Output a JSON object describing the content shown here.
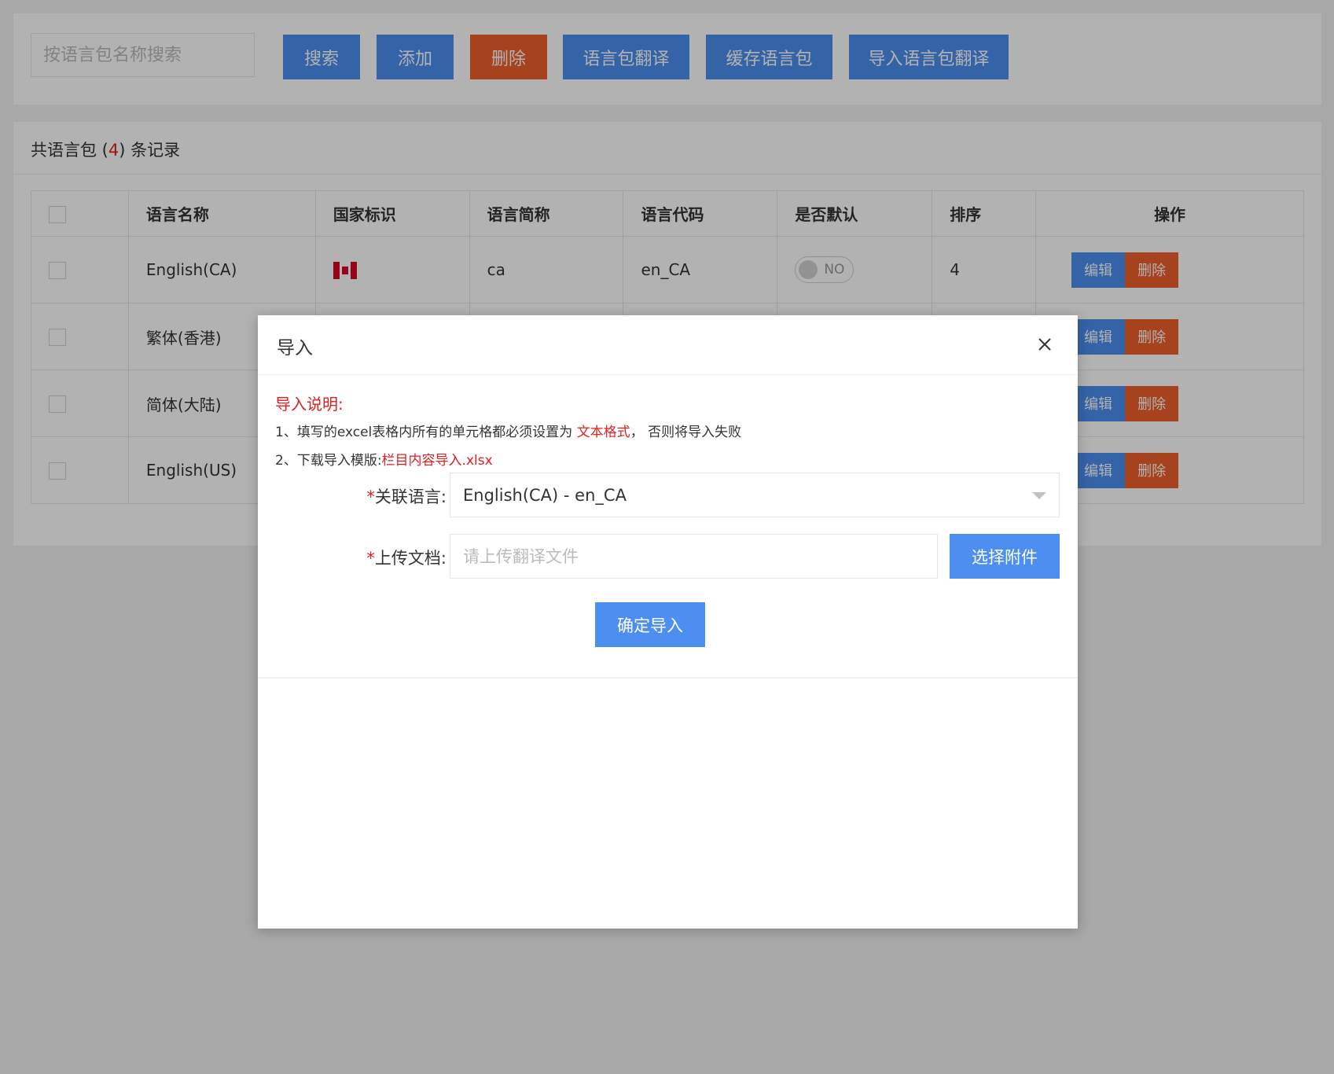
{
  "toolbar": {
    "search_placeholder": "按语言包名称搜索",
    "search_label": "搜索",
    "add_label": "添加",
    "delete_label": "删除",
    "translate_label": "语言包翻译",
    "cache_label": "缓存语言包",
    "import_translate_label": "导入语言包翻译"
  },
  "summary": {
    "prefix": "共语言包 (",
    "count": "4",
    "suffix": ") 条记录"
  },
  "table": {
    "headers": [
      "语言名称",
      "国家标识",
      "语言简称",
      "语言代码",
      "是否默认",
      "排序",
      "操作"
    ],
    "rows": [
      {
        "name": "English(CA)",
        "abbr": "ca",
        "code": "en_CA",
        "default": "NO",
        "sort": "4",
        "flag": "canada-flag"
      },
      {
        "name": "繁体(香港)"
      },
      {
        "name": "简体(大陆)"
      },
      {
        "name": "English(US)"
      }
    ],
    "edit_label": "编辑",
    "delete_label": "删除"
  },
  "modal": {
    "title": "导入",
    "note_title": "导入说明:",
    "note1_prefix": "1、填写的excel表格内所有的单元格都必须设置为",
    "note1_highlight": "文本格式",
    "note1_suffix": "， 否则将导入失败",
    "note2_prefix": "2、下载导入模版:",
    "note2_link": "栏目内容导入.xlsx",
    "language_label": "关联语言:",
    "language_value": "English(CA) - en_CA",
    "upload_label": "上传文档:",
    "upload_placeholder": "请上传翻译文件",
    "choose_label": "选择附件",
    "confirm_label": "确定导入",
    "required_mark": "*"
  },
  "colors": {
    "primary": "#4d8ff0",
    "danger": "#ee5f2b",
    "highlight": "#e02020"
  }
}
